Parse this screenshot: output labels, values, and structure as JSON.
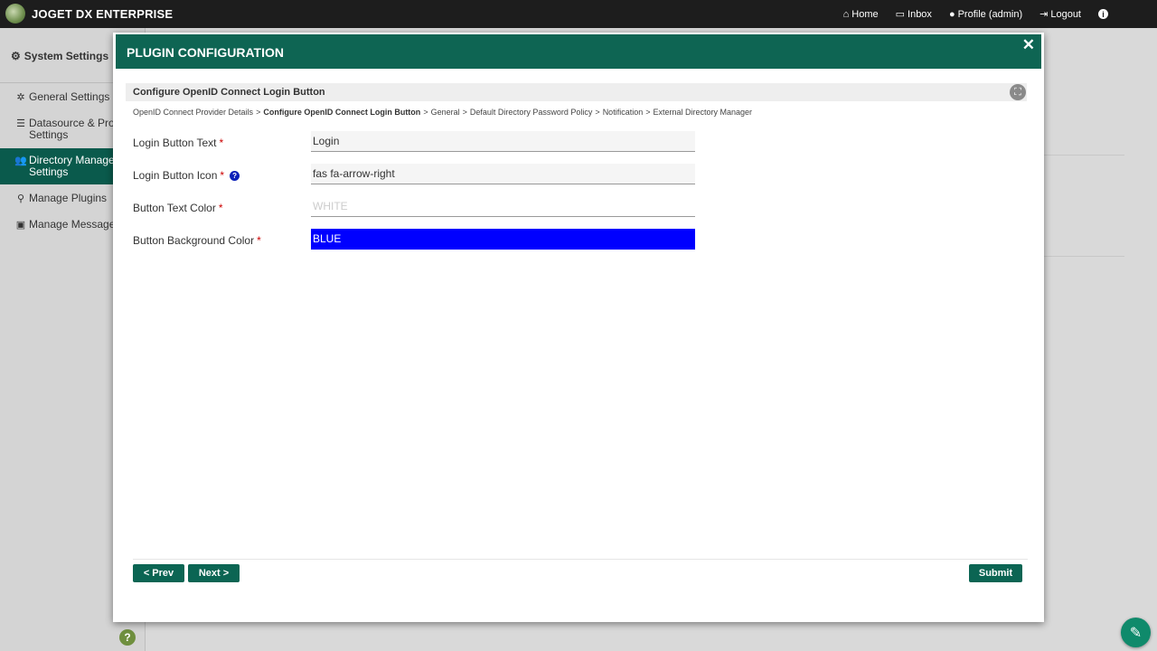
{
  "topbar": {
    "brand": "JOGET DX ENTERPRISE",
    "nav": [
      {
        "icon": "home-icon",
        "glyph": "⌂",
        "label": "Home"
      },
      {
        "icon": "inbox-icon",
        "glyph": "▭",
        "label": "Inbox"
      },
      {
        "icon": "user-icon",
        "glyph": "●",
        "label": "Profile (admin)"
      },
      {
        "icon": "logout-icon",
        "glyph": "⇥",
        "label": "Logout"
      }
    ],
    "info_glyph": "i"
  },
  "sidebar": {
    "title": "System Settings",
    "items": [
      {
        "label_line1": "General Settings",
        "label_line2": "",
        "glyph": "✲"
      },
      {
        "label_line1": "Datasource & Profi",
        "label_line2": "Settings",
        "glyph": "☰"
      },
      {
        "label_line1": "Directory Manager",
        "label_line2": "Settings",
        "glyph": "👥"
      },
      {
        "label_line1": "Manage Plugins",
        "label_line2": "",
        "glyph": "⚲"
      },
      {
        "label_line1": "Manage Messages",
        "label_line2": "",
        "glyph": "▣"
      }
    ],
    "help_glyph": "?"
  },
  "modal": {
    "title": "PLUGIN CONFIGURATION",
    "close_glyph": "✕",
    "section_title": "Configure OpenID Connect Login Button",
    "fullscreen_glyph": "⛶",
    "breadcrumb": {
      "step1": "OpenID Connect Provider Details",
      "step2": "Configure OpenID Connect Login Button",
      "step3": "General",
      "step4": "Default Directory Password Policy",
      "step5": "Notification",
      "step6": "External Directory Manager",
      "separator": ">"
    },
    "fields": [
      {
        "label": "Login Button Text",
        "required": "*",
        "value": "Login",
        "placeholder": ""
      },
      {
        "label": "Login Button Icon",
        "required": "*",
        "value": "fas fa-arrow-right",
        "placeholder": "",
        "help": "?"
      },
      {
        "label": "Button Text Color",
        "required": "*",
        "value": "",
        "placeholder": "WHITE"
      },
      {
        "label": "Button Background Color",
        "required": "*",
        "value": "BLUE",
        "placeholder": ""
      }
    ],
    "buttons": {
      "prev": "< Prev",
      "next": "Next >",
      "submit": "Submit"
    }
  },
  "colors": {
    "header": "#0e6553",
    "button": "#0b6553",
    "active_sidebar": "#0a5a4c",
    "bg_color_field": "#0000ff"
  },
  "edit_glyph": "✎"
}
